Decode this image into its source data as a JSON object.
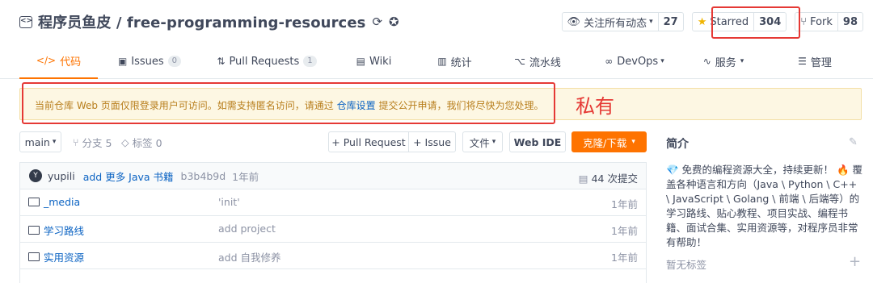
{
  "header": {
    "repo_title": "程序员鱼皮 / free-programming-resources",
    "actions": {
      "watch_label": "关注所有动态",
      "watch_count": "27",
      "star_label": "Starred",
      "star_count": "304",
      "fork_label": "Fork",
      "fork_count": "98"
    }
  },
  "tabs": [
    {
      "label": "代码",
      "icon": "code-icon"
    },
    {
      "label": "Issues",
      "badge": "0",
      "icon": "issues-icon"
    },
    {
      "label": "Pull Requests",
      "badge": "1",
      "icon": "pull-request-icon"
    },
    {
      "label": "Wiki",
      "icon": "wiki-icon"
    },
    {
      "label": "统计",
      "icon": "stats-icon"
    },
    {
      "label": "流水线",
      "icon": "pipeline-icon"
    },
    {
      "label": "DevOps",
      "icon": "devops-icon"
    },
    {
      "label": "服务",
      "icon": "service-icon"
    },
    {
      "label": "管理",
      "icon": "manage-icon"
    }
  ],
  "notice": {
    "text_before": "当前仓库 Web 页面仅限登录用户可访问。如需支持匿名访问，请通过 ",
    "link": "仓库设置",
    "text_after": " 提交公开申请，我们将尽快为您处理。",
    "annotation": "私有"
  },
  "toolbar": {
    "branch": "main",
    "branches": "分支 5",
    "tags": "标签 0",
    "new_pr": "+ Pull Request",
    "new_issue": "+ Issue",
    "files": "文件",
    "webide": "Web IDE",
    "clone": "克隆/下载"
  },
  "commit": {
    "avatar_letter": "Y",
    "author": "yupili",
    "message": "add 更多 Java 书籍",
    "hash": "b3b4b9d",
    "time": "1年前",
    "total": "44 次提交"
  },
  "files": [
    {
      "name": "_media",
      "commit": "'init'",
      "time": "1年前"
    },
    {
      "name": "学习路线",
      "commit": "add project",
      "time": "1年前"
    },
    {
      "name": "实用资源",
      "commit": "add 自我修养",
      "time": "1年前"
    }
  ],
  "sidebar": {
    "title": "简介",
    "description": "💎 免费的编程资源大全，持续更新！ 🔥 覆盖各种语言和方向（Java \\ Python \\ C++ \\ JavaScript \\ Golang \\ 前端 \\ 后端等）的学习路线、贴心教程、项目实战、编程书籍、面试合集、实用资源等，对程序员非常有帮助！",
    "no_tags": "暂无标签"
  },
  "colors": {
    "accent": "#fe7300",
    "link": "#0b63c3",
    "annotation": "#e53935",
    "notice_bg": "#fdf7e3"
  }
}
